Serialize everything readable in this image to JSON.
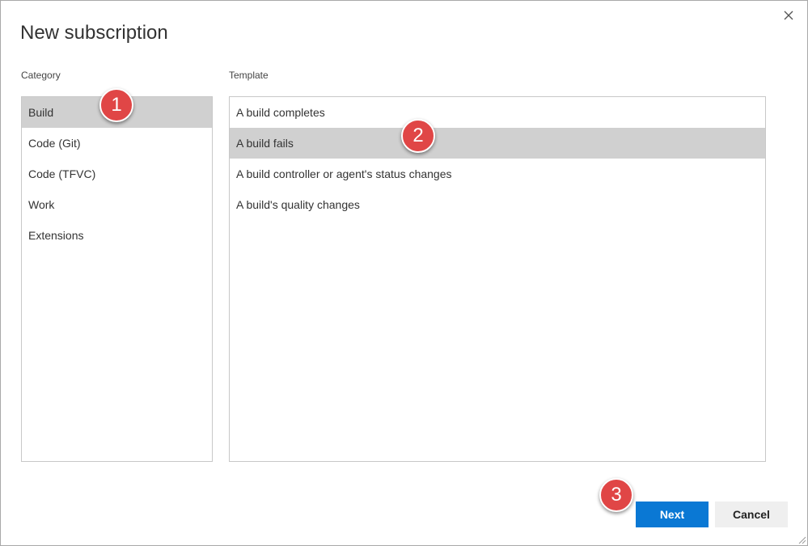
{
  "dialog": {
    "title": "New subscription",
    "close_icon": "close-icon"
  },
  "category": {
    "label": "Category",
    "items": [
      {
        "label": "Build",
        "selected": true
      },
      {
        "label": "Code (Git)",
        "selected": false
      },
      {
        "label": "Code (TFVC)",
        "selected": false
      },
      {
        "label": "Work",
        "selected": false
      },
      {
        "label": "Extensions",
        "selected": false
      }
    ]
  },
  "template": {
    "label": "Template",
    "items": [
      {
        "label": "A build completes",
        "selected": false
      },
      {
        "label": "A build fails",
        "selected": true
      },
      {
        "label": "A build controller or agent's status changes",
        "selected": false
      },
      {
        "label": "A build's quality changes",
        "selected": false
      }
    ]
  },
  "annotations": {
    "step1": "1",
    "step2": "2",
    "step3": "3",
    "color": "#e04646"
  },
  "buttons": {
    "next_label": "Next",
    "cancel_label": "Cancel",
    "primary_color": "#0a78d4"
  }
}
